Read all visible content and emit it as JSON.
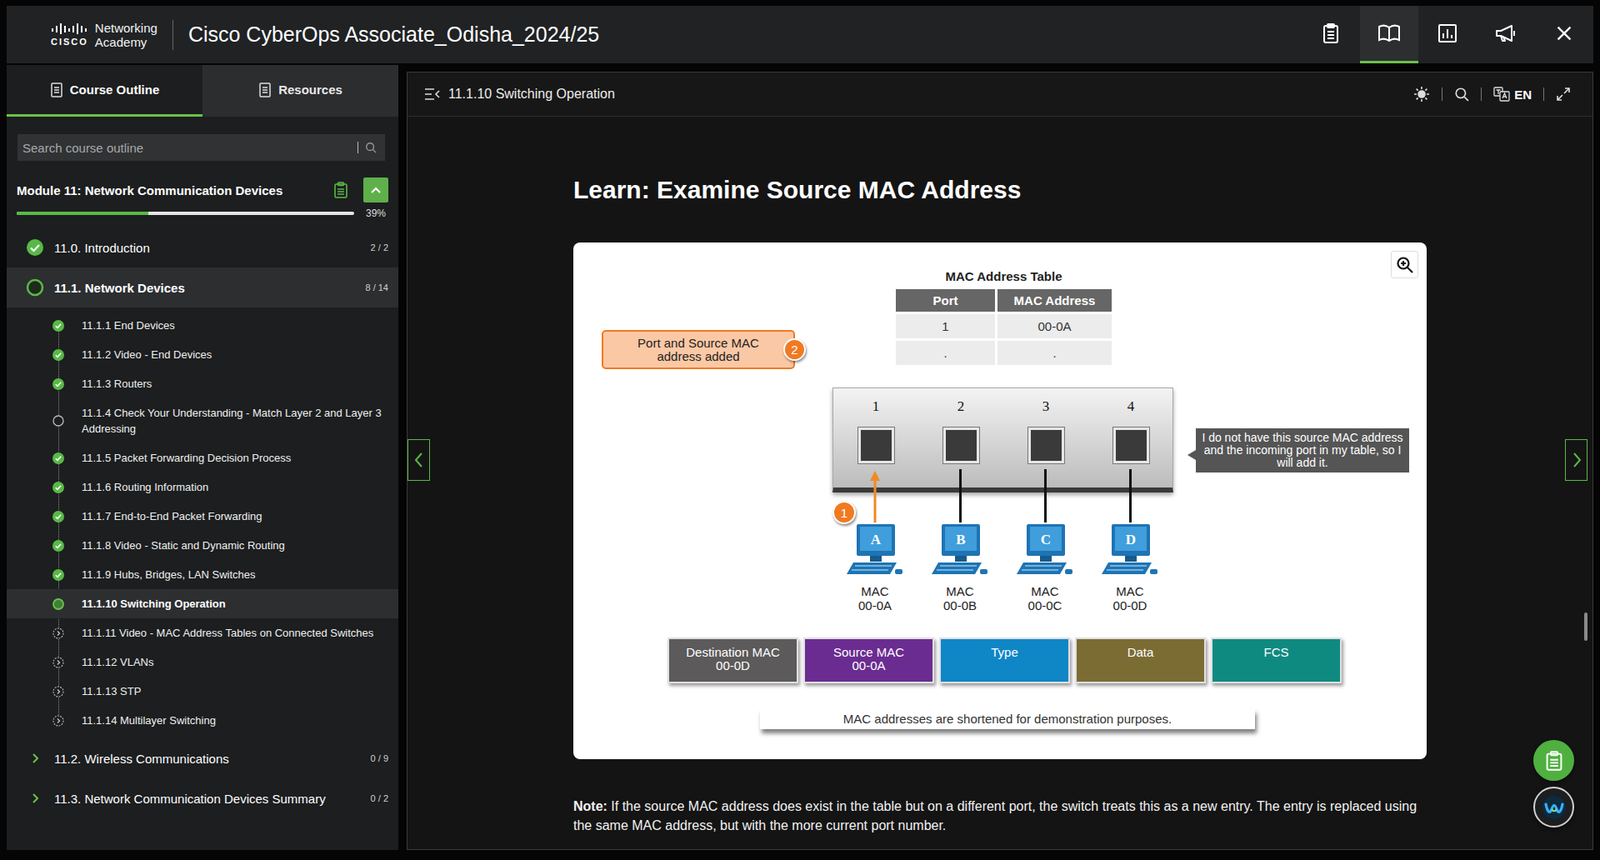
{
  "window": {
    "title": "Cisco CyberOps Associate_Odisha_2024/25"
  },
  "logo": {
    "brand": "CISCO",
    "line1": "Networking",
    "line2": "Academy"
  },
  "toolbar": [
    {
      "selected": false
    },
    {
      "selected": true
    },
    {
      "selected": false
    },
    {
      "selected": false
    }
  ],
  "sidebar": {
    "tabs": [
      {
        "label": "Course Outline",
        "selected": true
      },
      {
        "label": "Resources",
        "selected": false
      }
    ],
    "search": {
      "placeholder": "Search course outline"
    },
    "module": {
      "title": "Module 11: Network Communication Devices",
      "expanded": true,
      "progress": "39%",
      "level": 0.39
    },
    "sections": [
      {
        "title": "11.0. Introduction",
        "count": "2 / 2",
        "status": "complete",
        "expanded": false,
        "selected": false
      },
      {
        "title": "11.1. Network Devices",
        "count": "8 / 14",
        "status": "in-progress",
        "expanded": true,
        "selected": true,
        "lessons": [
          {
            "title": "11.1.1 End Devices",
            "status": "complete",
            "selected": false
          },
          {
            "title": "11.1.2 Video - End Devices",
            "status": "complete",
            "selected": false
          },
          {
            "title": "11.1.3 Routers",
            "status": "complete",
            "selected": false
          },
          {
            "title": "11.1.4 Check Your Understanding - Match Layer 2 and Layer 3 Addressing",
            "status": "unvisited",
            "selected": false
          },
          {
            "title": "11.1.5 Packet Forwarding Decision Process",
            "status": "complete",
            "selected": false
          },
          {
            "title": "11.1.6 Routing Information",
            "status": "complete",
            "selected": false
          },
          {
            "title": "11.1.7 End-to-End Packet Forwarding",
            "status": "complete",
            "selected": false
          },
          {
            "title": "11.1.8 Video - Static and Dynamic Routing",
            "status": "complete",
            "selected": false
          },
          {
            "title": "11.1.9 Hubs, Bridges, LAN Switches",
            "status": "complete",
            "selected": false
          },
          {
            "title": "11.1.10 Switching Operation",
            "status": "current",
            "selected": true
          },
          {
            "title": "11.1.11 Video - MAC Address Tables on Connected Switches",
            "status": "upcoming",
            "selected": false
          },
          {
            "title": "11.1.12 VLANs",
            "status": "upcoming",
            "selected": false
          },
          {
            "title": "11.1.13 STP",
            "status": "upcoming",
            "selected": false
          },
          {
            "title": "11.1.14 Multilayer Switching",
            "status": "upcoming",
            "selected": false
          }
        ]
      },
      {
        "title": "11.2. Wireless Communications",
        "count": "0 / 9",
        "status": "none",
        "expanded": false,
        "selected": false
      },
      {
        "title": "11.3. Network Communication Devices Summary",
        "count": "0 / 2",
        "status": "none",
        "expanded": false,
        "selected": false
      }
    ]
  },
  "content": {
    "breadcrumb": "11.1.10 Switching Operation",
    "language": "EN",
    "heading": "Learn: Examine Source MAC Address",
    "note_label": "Note:",
    "note": "If the source MAC address does exist in the table but on a different port, the switch treats this as a new entry. The entry is replaced using the same MAC address, but with the more current port number."
  },
  "diagram": {
    "table_title": "MAC Address Table",
    "columns": [
      "Port",
      "MAC Address"
    ],
    "rows": [
      [
        "1",
        "00-0A"
      ],
      [
        ".",
        "."
      ]
    ],
    "callout_added": {
      "text": "Port and Source MAC address added",
      "badge": "2"
    },
    "switch_ports": [
      "1",
      "2",
      "3",
      "4"
    ],
    "switch_message": "I do not have this source MAC address and the incoming port in my table, so I will add it.",
    "hosts": [
      {
        "name": "A",
        "mac_label": "MAC",
        "mac": "00-0A",
        "sending": true,
        "badge": "1"
      },
      {
        "name": "B",
        "mac_label": "MAC",
        "mac": "00-0B",
        "sending": false
      },
      {
        "name": "C",
        "mac_label": "MAC",
        "mac": "00-0C",
        "sending": false
      },
      {
        "name": "D",
        "mac_label": "MAC",
        "mac": "00-0D",
        "sending": false
      }
    ],
    "frame": [
      {
        "label": "Destination MAC",
        "value": "00-0D",
        "color": "#5c5a5b"
      },
      {
        "label": "Source MAC",
        "value": "00-0A",
        "color": "#6a2c91"
      },
      {
        "label": "Type",
        "color": "#0f86c6"
      },
      {
        "label": "Data",
        "color": "#7b6c33"
      },
      {
        "label": "FCS",
        "color": "#0f8a80"
      }
    ],
    "caption": "MAC addresses are shortened for demonstration purposes."
  }
}
